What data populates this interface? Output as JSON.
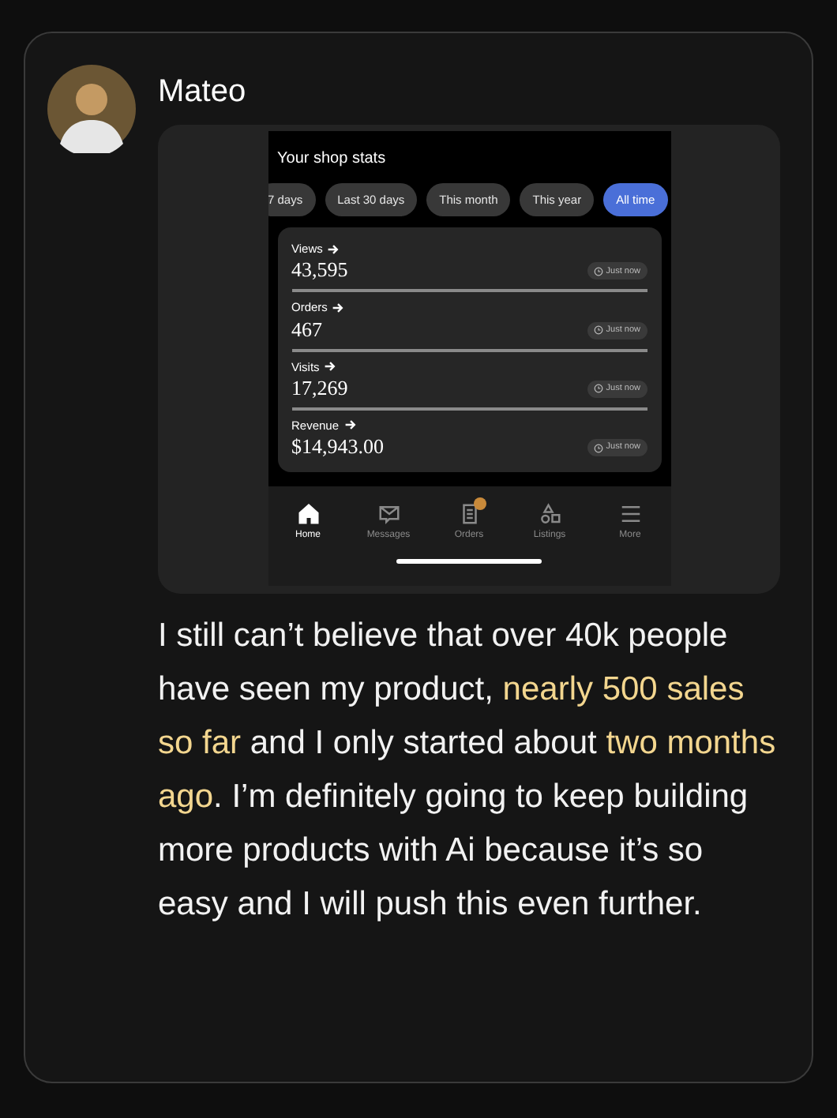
{
  "post": {
    "author": "Mateo"
  },
  "screenshot": {
    "title": "Your shop stats",
    "ranges": [
      {
        "label": "7 days",
        "selected": false
      },
      {
        "label": "Last 30 days",
        "selected": false
      },
      {
        "label": "This month",
        "selected": false
      },
      {
        "label": "This year",
        "selected": false
      },
      {
        "label": "All time",
        "selected": true
      }
    ],
    "stats": [
      {
        "label": "Views",
        "value": "43,595",
        "updated": "Just now"
      },
      {
        "label": "Orders",
        "value": "467",
        "updated": "Just now"
      },
      {
        "label": "Visits",
        "value": "17,269",
        "updated": "Just now"
      },
      {
        "label": "Revenue",
        "value": "$14,943.00",
        "updated": "Just now"
      }
    ],
    "nav": [
      {
        "label": "Home",
        "kind": "home",
        "selected": true,
        "badge": false
      },
      {
        "label": "Messages",
        "kind": "messages",
        "selected": false,
        "badge": false
      },
      {
        "label": "Orders",
        "kind": "orders",
        "selected": false,
        "badge": true
      },
      {
        "label": "Listings",
        "kind": "listings",
        "selected": false,
        "badge": false
      },
      {
        "label": "More",
        "kind": "more",
        "selected": false,
        "badge": false
      }
    ]
  },
  "message": [
    {
      "text": "I still can’t believe that over 40k people have seen my product, ",
      "highlight": false
    },
    {
      "text": "nearly 500 sales so far",
      "highlight": true
    },
    {
      "text": " and I only started about ",
      "highlight": false
    },
    {
      "text": "two months ago",
      "highlight": true
    },
    {
      "text": ". I’m definitely going to keep building more products with Ai because it’s so easy and I will push this even further.",
      "highlight": false
    }
  ]
}
